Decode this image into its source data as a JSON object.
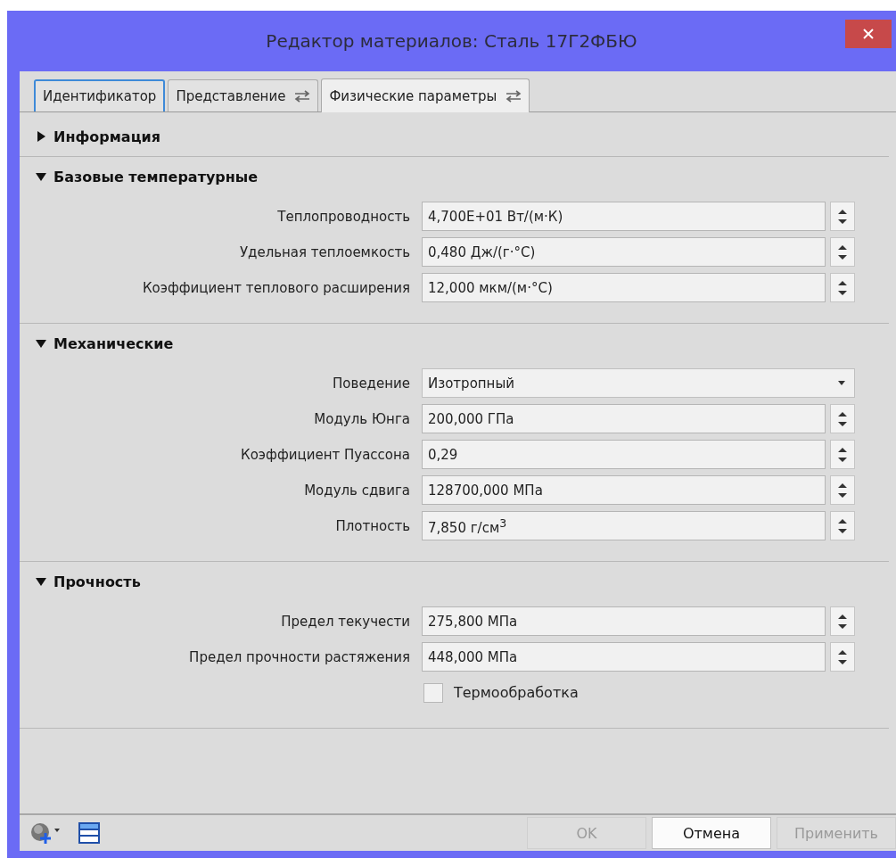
{
  "window": {
    "title": "Редактор материалов: Сталь 17Г2ФБЮ"
  },
  "tabs": [
    {
      "label": "Идентификатор",
      "selected": false,
      "focused": true,
      "linked": false
    },
    {
      "label": "Представление",
      "selected": false,
      "focused": false,
      "linked": true
    },
    {
      "label": "Физические параметры",
      "selected": true,
      "focused": false,
      "linked": true
    }
  ],
  "sections": [
    {
      "title": "Информация",
      "expanded": false
    },
    {
      "title": "Базовые температурные",
      "expanded": true,
      "rows": [
        {
          "kind": "spin",
          "label": "Теплопроводность",
          "value": "4,700E+01 Вт/(м·К)"
        },
        {
          "kind": "spin",
          "label": "Удельная теплоемкость",
          "value": "0,480 Дж/(г·°C)"
        },
        {
          "kind": "spin",
          "label": "Коэффициент теплового расширения",
          "value": "12,000 мкм/(м·°C)"
        }
      ]
    },
    {
      "title": "Механические",
      "expanded": true,
      "rows": [
        {
          "kind": "combo",
          "label": "Поведение",
          "value": "Изотропный"
        },
        {
          "kind": "spin",
          "label": "Модуль Юнга",
          "value": "200,000 ГПа"
        },
        {
          "kind": "spin",
          "label": "Коэффициент Пуассона",
          "value": "0,29"
        },
        {
          "kind": "spin",
          "label": "Модуль сдвига",
          "value": "128700,000 МПа"
        },
        {
          "kind": "spin",
          "label": "Плотность",
          "value": "7,850 г/см$^{3}$"
        }
      ]
    },
    {
      "title": "Прочность",
      "expanded": true,
      "rows": [
        {
          "kind": "spin",
          "label": "Предел текучести",
          "value": "275,800 МПа"
        },
        {
          "kind": "spin",
          "label": "Предел прочности растяжения",
          "value": "448,000 МПа"
        },
        {
          "kind": "checkbox",
          "label": "Термообработка",
          "checked": false
        }
      ]
    }
  ],
  "buttons": [
    {
      "label": "OK",
      "disabled": true
    },
    {
      "label": "Отмена",
      "disabled": false
    },
    {
      "label": "Применить",
      "disabled": true
    }
  ]
}
